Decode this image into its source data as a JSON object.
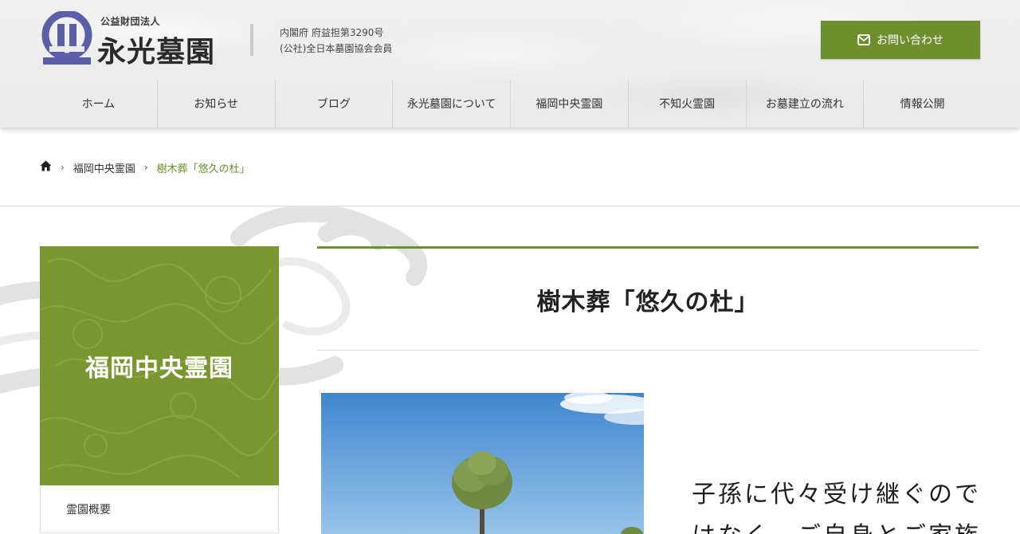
{
  "header": {
    "logo_sub": "公益財団法人",
    "logo_name": "永光墓園",
    "org_line1": "内閣府 府益担第3290号",
    "org_line2": "(公社)全日本墓園協会会員",
    "contact_label": "お問い合わせ",
    "contact_icon": "envelope-icon"
  },
  "nav": {
    "items": [
      "ホーム",
      "お知らせ",
      "ブログ",
      "永光墓園について",
      "福岡中央霊園",
      "不知火霊園",
      "お墓建立の流れ",
      "情報公開"
    ]
  },
  "breadcrumb": {
    "home_icon": "home-icon",
    "parent": "福岡中央霊園",
    "current": "樹木葬「悠久の杜」"
  },
  "sidebar": {
    "title": "福岡中央霊園",
    "items": [
      "霊園概要"
    ]
  },
  "main": {
    "title": "樹木葬「悠久の杜」",
    "lead_line1": "子孫に代々受け継ぐので",
    "lead_line2": "はなく、ご自身とご家族"
  },
  "colors": {
    "accent": "#6e8f2e",
    "sidebar_bg": "#7a9630",
    "logo_blue": "#5a5fa8"
  }
}
